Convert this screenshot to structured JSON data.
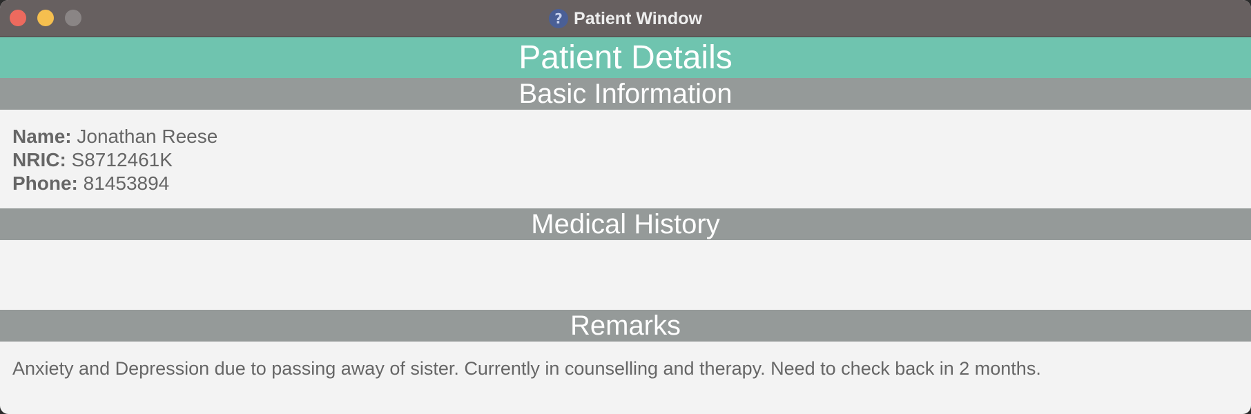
{
  "window": {
    "title": "Patient Window",
    "app_icon": "?"
  },
  "header": {
    "title": "Patient Details"
  },
  "basic_information": {
    "title": "Basic Information",
    "fields": [
      {
        "label": "Name:",
        "value": "Jonathan Reese"
      },
      {
        "label": "NRIC:",
        "value": "S8712461K"
      },
      {
        "label": "Phone:",
        "value": "81453894"
      }
    ]
  },
  "medical_history": {
    "title": "Medical History"
  },
  "remarks": {
    "title": "Remarks",
    "text": "Anxiety and Depression due to passing away of sister. Currently in counselling and therapy. Need to check back in 2 months."
  },
  "colors": {
    "header_bar": "#6fc4af",
    "section_bar": "#959a99",
    "titlebar": "#676060",
    "content_background": "#f3f3f3",
    "text": "#666666"
  }
}
